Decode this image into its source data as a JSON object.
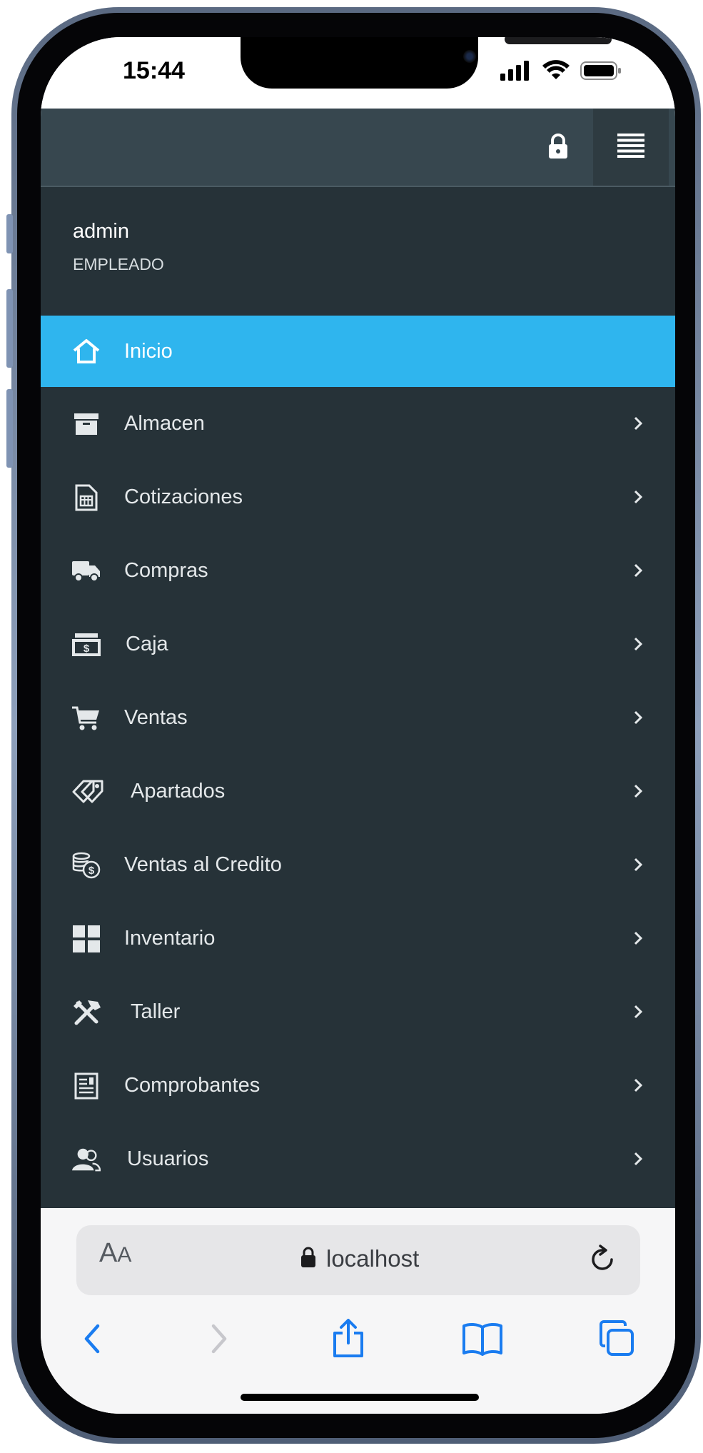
{
  "status_bar": {
    "time": "15:44"
  },
  "header": {
    "lock_icon": "lock-icon",
    "menu_icon": "menu-icon"
  },
  "user": {
    "name": "admin",
    "role": "EMPLEADO"
  },
  "menu": {
    "items": [
      {
        "label": "Inicio",
        "icon": "home-icon",
        "active": true
      },
      {
        "label": "Almacen",
        "icon": "archive-box-icon"
      },
      {
        "label": "Cotizaciones",
        "icon": "calculator-document-icon"
      },
      {
        "label": "Compras",
        "icon": "truck-icon"
      },
      {
        "label": "Caja",
        "icon": "cash-register-icon"
      },
      {
        "label": "Ventas",
        "icon": "cart-icon"
      },
      {
        "label": "Apartados",
        "icon": "tags-icon"
      },
      {
        "label": "Ventas al Credito",
        "icon": "coins-icon"
      },
      {
        "label": "Inventario",
        "icon": "grid-icon"
      },
      {
        "label": "Taller",
        "icon": "tools-icon"
      },
      {
        "label": "Comprobantes",
        "icon": "receipt-icon"
      },
      {
        "label": "Usuarios",
        "icon": "users-icon"
      }
    ]
  },
  "browser": {
    "text_size_label": "AA",
    "url": "localhost",
    "accent_color": "#1a7cf0",
    "highlight_color": "#2fb5ee"
  }
}
